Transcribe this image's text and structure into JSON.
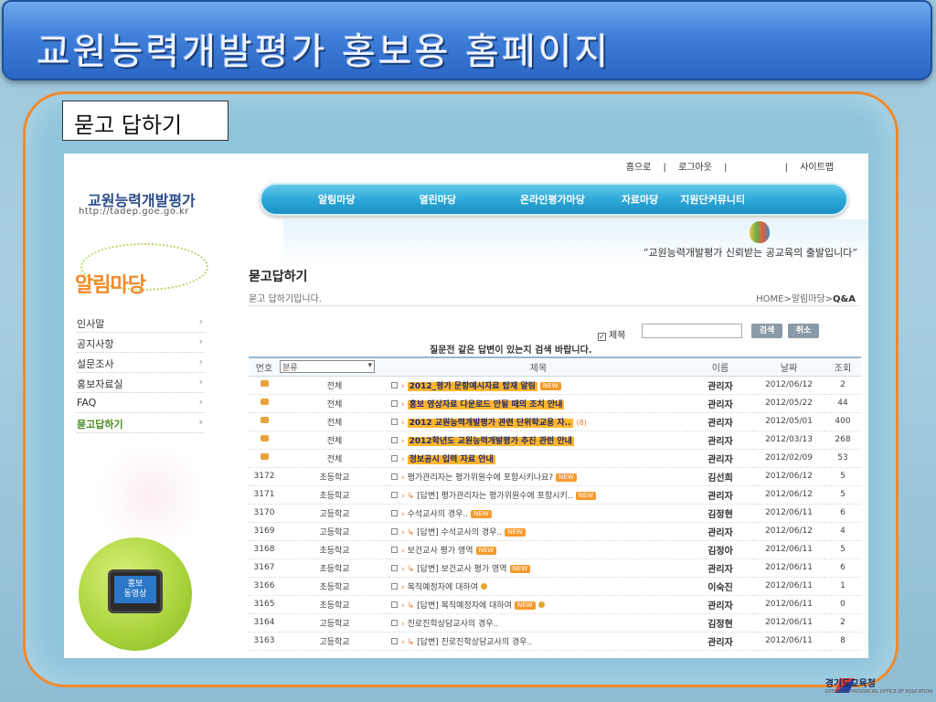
{
  "slide": {
    "title": "교원능력개발평가 홍보용 홈페이지",
    "caption": "묻고 답하기"
  },
  "site": {
    "top_links": [
      "홈으로",
      "|",
      "로그아웃",
      "|",
      "|",
      "사이트맵"
    ],
    "logo_title": "교원능력개발평가",
    "logo_url": "http://tadep.goe.go.kr",
    "gnb": [
      "알림마당",
      "열린마당",
      "온라인평가마당",
      "자료마당",
      "지원단커뮤니티"
    ],
    "slogan": "“교원능력개발평가 신뢰받는 공교육의 출발입니다”",
    "lnb_title": "알림마당",
    "lnb_items": [
      "인사말",
      "공지사항",
      "설문조사",
      "홍보자료실",
      "FAQ",
      "묻고답하기"
    ],
    "video_label_1": "홍보",
    "video_label_2": "동영상"
  },
  "content": {
    "page_title": "묻고답하기",
    "page_sub": "묻고 답하기입니다.",
    "breadcrumb_prefix": "HOME>알림마당>",
    "breadcrumb_current": "Q&A",
    "filter_label": "제목",
    "search_button": "검색",
    "cancel_button": "취소",
    "notice": "질문전 같은 답변이 있는지 검색 바랍니다.",
    "category_default": "분류"
  },
  "table": {
    "headers": [
      "번호",
      "제목",
      "이름",
      "날짜",
      "조회"
    ],
    "rows": [
      {
        "no": "",
        "cat": "전체",
        "subject": "2012_평가 문항예시자료 탑재 알림",
        "new": true,
        "reply": false,
        "hl": true,
        "name": "관리자",
        "date": "2012/06/12",
        "views": "2"
      },
      {
        "no": "",
        "cat": "전체",
        "subject": "홍보 영상자료 다운로드 안될 때의 조치 안내",
        "new": false,
        "reply": false,
        "hl": true,
        "name": "관리자",
        "date": "2012/05/22",
        "views": "44"
      },
      {
        "no": "",
        "cat": "전체",
        "subject": "2012 교원능력개발평가 관련 단위학교용 자..",
        "new": false,
        "reply": false,
        "hl": true,
        "count": "(8)",
        "name": "관리자",
        "date": "2012/05/01",
        "views": "400"
      },
      {
        "no": "",
        "cat": "전체",
        "subject": "2012학년도 교원능력개발평가 추진 관련 안내",
        "new": false,
        "reply": false,
        "hl": true,
        "name": "관리자",
        "date": "2012/03/13",
        "views": "268"
      },
      {
        "no": "",
        "cat": "전체",
        "subject": "정보공시 입력 자료 안내",
        "new": false,
        "reply": false,
        "hl": true,
        "name": "관리자",
        "date": "2012/02/09",
        "views": "53"
      },
      {
        "no": "3172",
        "cat": "초등학교",
        "subject": "평가관리자는 평가위원수에 포함시키나요?",
        "new": true,
        "reply": false,
        "hl": false,
        "name": "김선희",
        "date": "2012/06/12",
        "views": "5"
      },
      {
        "no": "3171",
        "cat": "초등학교",
        "subject": "[답변] 평가관리자는 평가위원수에 포함시키..",
        "new": true,
        "reply": true,
        "hl": false,
        "name": "관리자",
        "date": "2012/06/12",
        "views": "5"
      },
      {
        "no": "3170",
        "cat": "고등학교",
        "subject": "수석교사의 경우..",
        "new": true,
        "reply": false,
        "hl": false,
        "name": "김정현",
        "date": "2012/06/11",
        "views": "6"
      },
      {
        "no": "3169",
        "cat": "고등학교",
        "subject": "[답변] 수석교사의 경우..",
        "new": true,
        "reply": true,
        "hl": false,
        "name": "관리자",
        "date": "2012/06/12",
        "views": "4"
      },
      {
        "no": "3168",
        "cat": "초등학교",
        "subject": "보건교사 평가 영역",
        "new": true,
        "reply": false,
        "hl": false,
        "name": "김정아",
        "date": "2012/06/11",
        "views": "5"
      },
      {
        "no": "3167",
        "cat": "초등학교",
        "subject": "[답변] 보건교사 평가 영역",
        "new": true,
        "reply": true,
        "hl": false,
        "name": "관리자",
        "date": "2012/06/11",
        "views": "6"
      },
      {
        "no": "3166",
        "cat": "초등학교",
        "subject": "복직예정자에 대하여",
        "new": false,
        "reply": false,
        "hl": false,
        "lock": true,
        "name": "이숙진",
        "date": "2012/06/11",
        "views": "1"
      },
      {
        "no": "3165",
        "cat": "초등학교",
        "subject": "[답변] 복직예정자에 대하여",
        "new": true,
        "reply": true,
        "hl": false,
        "lock": true,
        "name": "관리자",
        "date": "2012/06/11",
        "views": "0"
      },
      {
        "no": "3164",
        "cat": "고등학교",
        "subject": "진로진학상담교사의 경우..",
        "new": false,
        "reply": false,
        "hl": false,
        "name": "김정현",
        "date": "2012/06/11",
        "views": "2"
      },
      {
        "no": "3163",
        "cat": "고등학교",
        "subject": "[답변] 진로진학상담교사의 경우..",
        "new": false,
        "reply": true,
        "hl": false,
        "name": "관리자",
        "date": "2012/06/11",
        "views": "8"
      }
    ],
    "new_label": "NEW"
  },
  "footer": {
    "brand": "경기도교육청",
    "brand_sub": "GYEONGGI PROVINCIAL OFFICE OF EDUCATION"
  }
}
